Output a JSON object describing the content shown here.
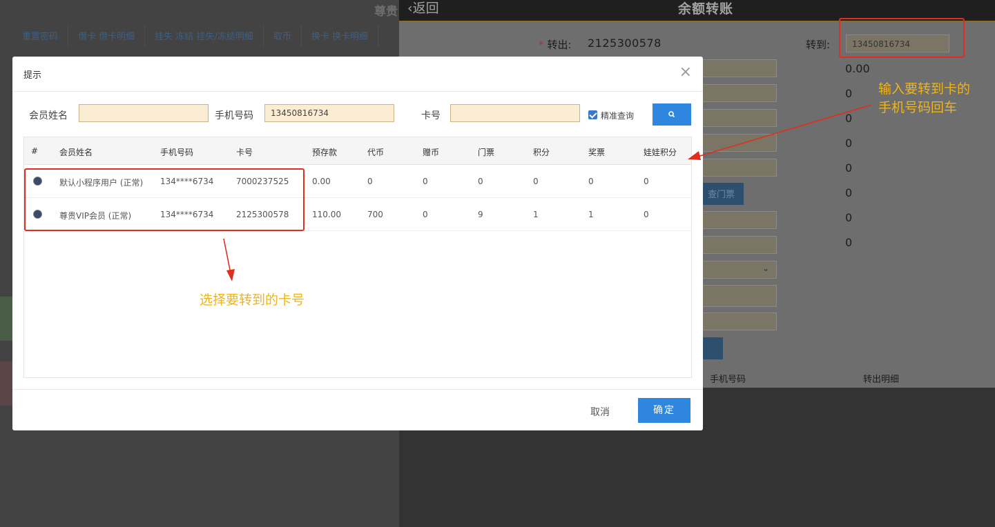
{
  "background_left": {
    "title": "尊贵",
    "tabs": [
      "重置密码",
      "借卡 借卡明细",
      "挂失 冻结 挂失/冻结明细",
      "取币",
      "换卡 换卡明细"
    ]
  },
  "transfer_panel": {
    "back_label": "返回",
    "title": "余额转账",
    "out_label": "转出:",
    "out_value": "2125300578",
    "to_label": "转到:",
    "to_value": "13450816734",
    "amounts": [
      "0.00",
      "0",
      "0",
      "0",
      "0",
      "0",
      "0",
      "0"
    ],
    "ticket_button": "查门票",
    "table_headers": [
      "手机号码",
      "转出明细"
    ]
  },
  "annotations": {
    "phone_hint": "输入要转到卡的\n手机号码回车",
    "select_hint": "选择要转到的卡号"
  },
  "modal": {
    "title": "提示",
    "close_icon": "close-icon",
    "search": {
      "name_label": "会员姓名",
      "name_value": "",
      "phone_label": "手机号码",
      "phone_value": "13450816734",
      "card_label": "卡号",
      "card_value": "",
      "exact_label": "精准查询",
      "exact_checked": true,
      "search_icon": "search-icon"
    },
    "table": {
      "headers": [
        "#",
        "会员姓名",
        "手机号码",
        "卡号",
        "预存款",
        "代币",
        "赠币",
        "门票",
        "积分",
        "奖票",
        "娃娃积分"
      ],
      "rows": [
        [
          "默认小程序用户 (正常)",
          "134****6734",
          "7000237525",
          "0.00",
          "0",
          "0",
          "0",
          "0",
          "0",
          "0"
        ],
        [
          "尊贵VIP会员 (正常)",
          "134****6734",
          "2125300578",
          "110.00",
          "700",
          "0",
          "9",
          "1",
          "1",
          "0"
        ]
      ]
    },
    "cancel_label": "取消",
    "ok_label": "确定"
  },
  "colors": {
    "primary": "#2e86de",
    "annotation_red": "#e02e1e",
    "annotation_orange": "#f0b41b",
    "input_bg": "#fbecd4"
  }
}
